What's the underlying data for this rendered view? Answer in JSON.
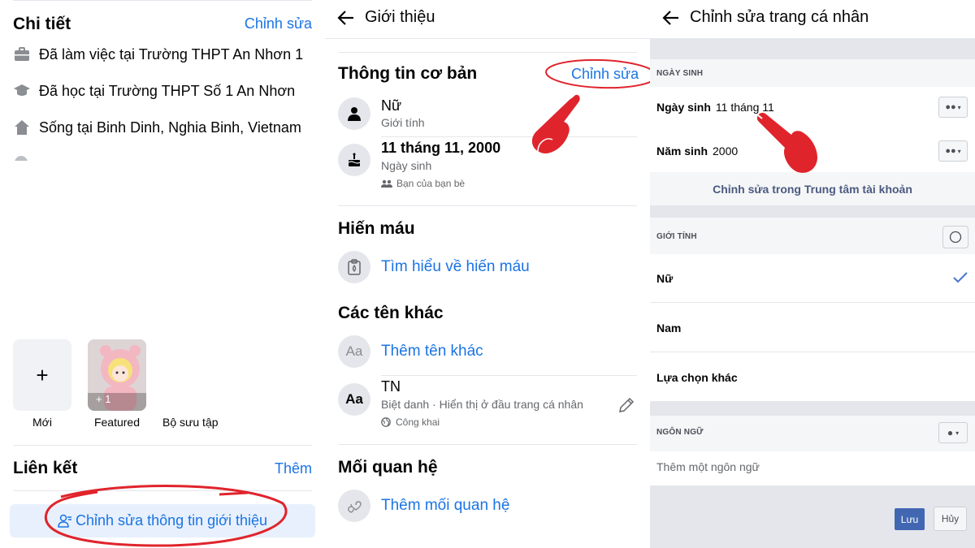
{
  "panel1": {
    "details_title": "Chi tiết",
    "details_edit": "Chỉnh sửa",
    "work": "Đã làm việc tại Trường THPT An Nhơn 1",
    "study": "Đã học tại Trường THPT Số 1 An Nhơn",
    "lives": "Sống tại Binh Dinh, Nghia Binh, Vietnam",
    "tiles": {
      "new_label": "Mới",
      "featured_label": "Featured",
      "featured_count": "+ 1",
      "collection_label": "Bộ sưu tập"
    },
    "links_title": "Liên kết",
    "links_add": "Thêm",
    "edit_intro_button": "Chỉnh sửa thông tin giới thiệu"
  },
  "panel2": {
    "header_title": "Giới thiệu",
    "basic_info_title": "Thông tin cơ bản",
    "basic_info_edit": "Chỉnh sửa",
    "gender_value": "Nữ",
    "gender_label": "Giới tính",
    "birthday_value": "11 tháng 11, 2000",
    "birthday_label": "Ngày sinh",
    "birthday_audience": "Bạn của bạn bè",
    "blood_title": "Hiến máu",
    "blood_link": "Tìm hiểu về hiến máu",
    "other_names_title": "Các tên khác",
    "add_other_name": "Thêm tên khác",
    "nickname_value": "TN",
    "nickname_desc": "Biệt danh · Hiển thị ở đầu trang cá nhân",
    "nickname_audience": "Công khai",
    "relationship_title": "Mối quan hệ",
    "add_relationship": "Thêm mối quan hệ",
    "aa": "Aa"
  },
  "panel3": {
    "header_title": "Chỉnh sửa trang cá nhân",
    "birthday_section": "NGÀY SINH",
    "birthday_label": "Ngày sinh",
    "birthday_value": "11 tháng 11",
    "birthyear_label": "Năm sinh",
    "birthyear_value": "2000",
    "accounts_center_link": "Chỉnh sửa trong Trung tâm tài khoản",
    "gender_section": "GIỚI TÍNH",
    "gender_options": [
      "Nữ",
      "Nam",
      "Lựa chọn khác"
    ],
    "selected_gender": "Nữ",
    "language_section": "NGÔN NGỮ",
    "language_placeholder": "Thêm một ngôn ngữ",
    "save_button": "Lưu",
    "cancel_button": "Hủy"
  },
  "colors": {
    "accent": "#1b74e4",
    "annotation_red": "#e0242c",
    "fb_blue_dark": "#4267b2",
    "band_gray": "#e4e6eb"
  }
}
